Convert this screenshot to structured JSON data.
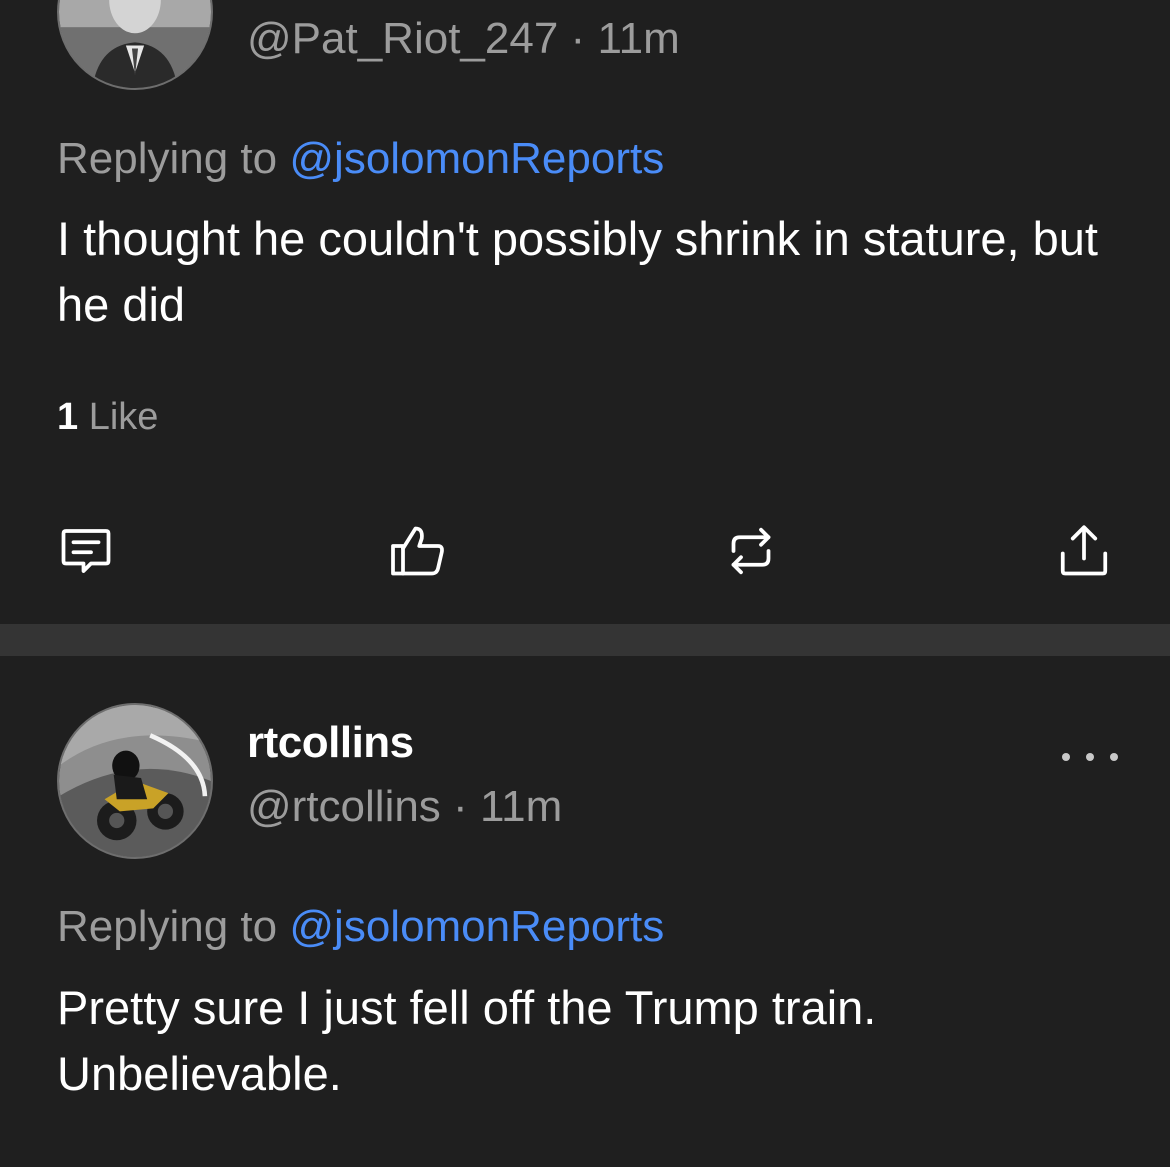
{
  "post1": {
    "handle": "@Pat_Riot_247",
    "separator": "·",
    "time": "11m",
    "replying_prefix": "Replying to",
    "replying_mention": "@jsolomonReports",
    "body": "I thought he couldn't possibly shrink in stature, but he did",
    "like_count": "1",
    "like_label": "Like"
  },
  "post2": {
    "display_name": "rtcollins",
    "handle": "@rtcollins",
    "separator": "·",
    "time": "11m",
    "replying_prefix": "Replying to",
    "replying_mention": "@jsolomonReports",
    "body_line1": "Pretty sure I just fell off the Trump train.",
    "body_line2": "Unbelievable."
  },
  "actions": [
    {
      "icon": "comment-icon"
    },
    {
      "icon": "thumbs-up-icon"
    },
    {
      "icon": "repost-icon"
    },
    {
      "icon": "share-icon"
    }
  ],
  "colors": {
    "background": "#1f1f1f",
    "divider": "#343434",
    "secondary_text": "#9c9c9c",
    "mention": "#4a8cf7"
  }
}
